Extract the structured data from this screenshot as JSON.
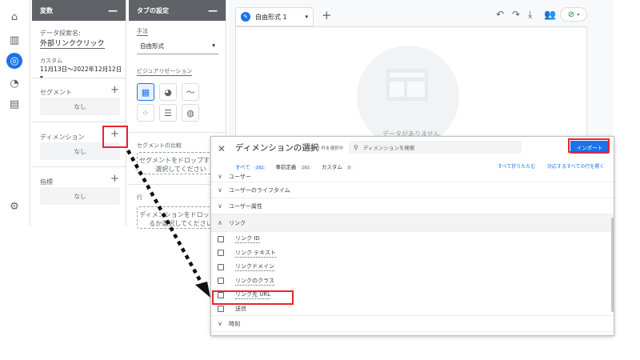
{
  "variables_panel": {
    "header": "変数",
    "data_source_label": "データ探索名:",
    "data_source_value": "外部リンククリック",
    "date_label": "カスタム",
    "date_range": "11月13日～2022年12月12日",
    "segments_label": "セグメント",
    "segments_empty": "なし",
    "dimensions_label": "ディメンション",
    "dimensions_empty": "なし",
    "metrics_label": "指標",
    "metrics_empty": "なし"
  },
  "tab_panel": {
    "header": "タブの設定",
    "technique_label": "手法",
    "technique_value": "自由形式",
    "viz_label": "ビジュアリゼーション",
    "segment_compare_label": "セグメントの比較",
    "segment_drop_text": "セグメントをドロップするか選択してください",
    "rows_label": "行",
    "dimension_drop_text": "ディメンションをドロップするか選択してください"
  },
  "canvas": {
    "tab_name": "自由形式 1",
    "empty_text": "データがありません"
  },
  "dialog": {
    "title": "ディメンションの選択",
    "count": "0/162 件を選択中",
    "search_placeholder": "ディメンションを検索",
    "import_button": "インポート",
    "tabs": [
      {
        "label": "すべて",
        "count": "162"
      },
      {
        "label": "事前定義",
        "count": "162"
      },
      {
        "label": "カスタム",
        "count": "0"
      }
    ],
    "collapse_all": "すべて折りたたむ",
    "expand_rows": "対応するすべての行を開く",
    "categories_top": [
      "ユーザー",
      "ユーザーのライフタイム",
      "ユーザー属性"
    ],
    "open_category": "リンク",
    "link_items": [
      "リンク ID",
      "リンク テキスト",
      "リンクドメイン",
      "リンクのクラス",
      "リンク先 URL"
    ],
    "categories_bottom": [
      "送信",
      "時刻"
    ]
  },
  "colors": {
    "accent": "#1a73e8",
    "highlight": "#e8252b",
    "panel_header": "#5f6368"
  }
}
